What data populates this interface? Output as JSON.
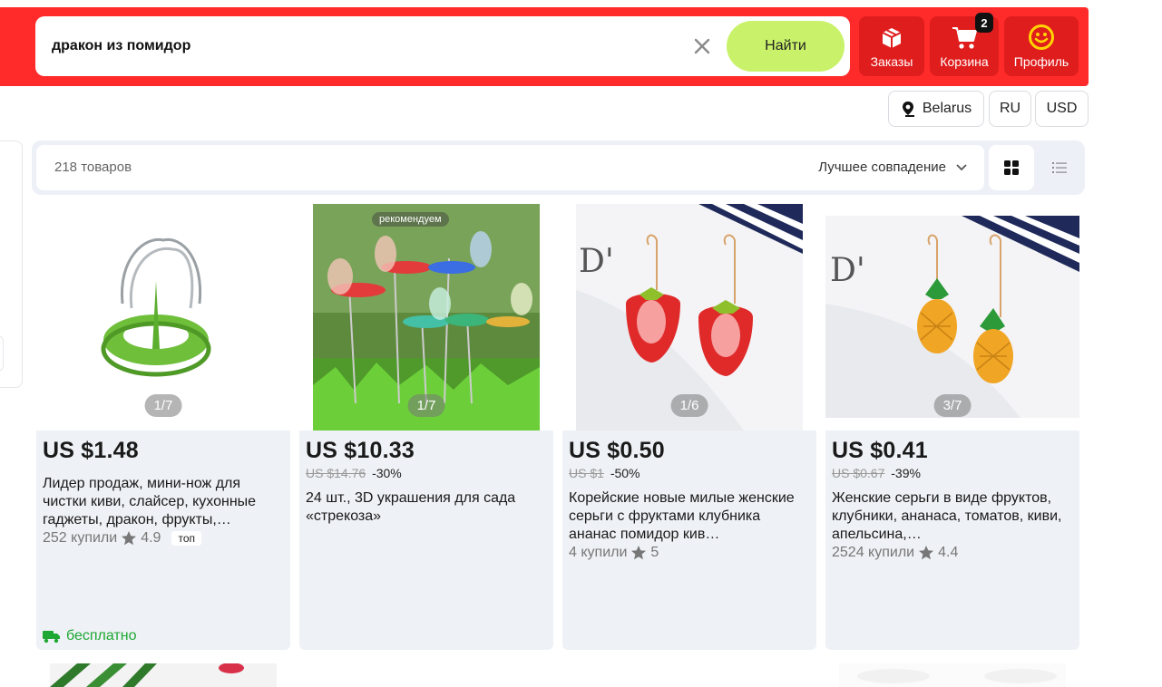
{
  "search": {
    "query": "дракон из помидор",
    "find_label": "Найти"
  },
  "header": {
    "orders_label": "Заказы",
    "cart_label": "Корзина",
    "cart_count": "2",
    "profile_label": "Профиль"
  },
  "locale": {
    "country": "Belarus",
    "language": "RU",
    "currency": "USD"
  },
  "toolbar": {
    "count": "218 товаров",
    "sort": "Лучшее совпадение"
  },
  "products": [
    {
      "price": "US $1.48",
      "old_price": "",
      "discount": "",
      "title": "Лидер продаж, мини-нож для чистки киви, слайсер, кухонные гаджеты, дракон, фрукты,…",
      "bought": "252 купили",
      "rating": "4.9",
      "badge": "топ",
      "counter": "1/7",
      "shipping": "бесплатно"
    },
    {
      "price": "US $10.33",
      "old_price": "US $14.76",
      "discount": "-30%",
      "title": "24 шт., 3D украшения для сада «стрекоза»",
      "counter": "1/7",
      "recommended": "рекомендуем"
    },
    {
      "price": "US $0.50",
      "old_price": "US $1",
      "discount": "-50%",
      "title": "Корейские новые милые женские серьги с фруктами клубника ананас помидор кив…",
      "bought": "4 купили",
      "rating": "5",
      "counter": "1/6"
    },
    {
      "price": "US $0.41",
      "old_price": "US $0.67",
      "discount": "-39%",
      "title": "Женские серьги в виде фруктов, клубники, ананаса, томатов, киви, апельсина,…",
      "bought": "2524 купили",
      "rating": "4.4",
      "counter": "3/7"
    }
  ],
  "colors": {
    "header_red": "#ff2b2b",
    "button_red": "#e01d1d",
    "find_green": "#c9f26a",
    "free_green": "#1ea833"
  }
}
